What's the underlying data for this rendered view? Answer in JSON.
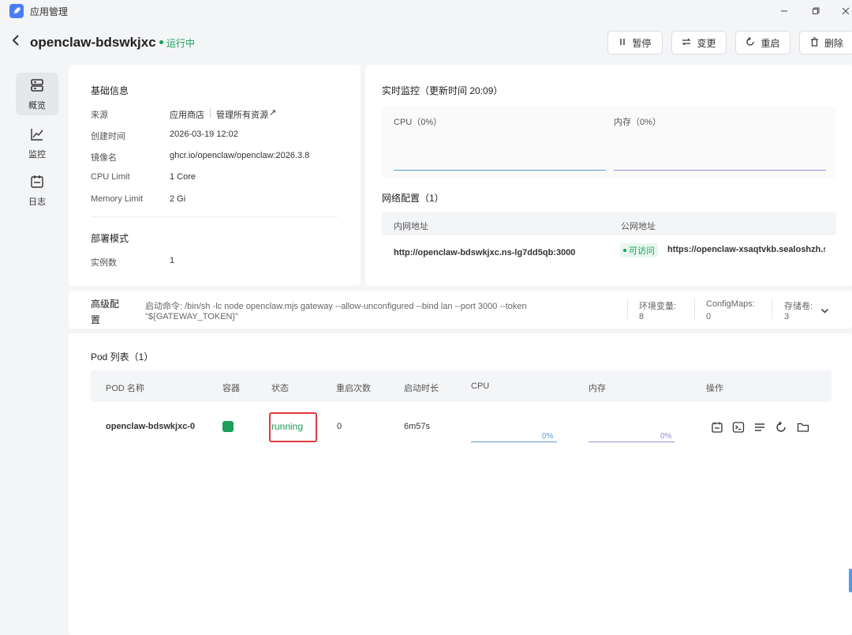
{
  "window": {
    "title": "应用管理",
    "controls": [
      "minimize",
      "restore",
      "close"
    ]
  },
  "header": {
    "app_name": "openclaw-bdswkjxc",
    "status": "运行中",
    "buttons": {
      "pause": "暂停",
      "change": "变更",
      "restart": "重启",
      "delete": "删除"
    }
  },
  "sidenav": {
    "items": [
      {
        "label": "概览",
        "icon": "server-icon",
        "active": true
      },
      {
        "label": "监控",
        "icon": "chart-line-icon",
        "active": false
      },
      {
        "label": "日志",
        "icon": "calendar-log-icon",
        "active": false
      }
    ]
  },
  "basic_info": {
    "title": "基础信息",
    "rows": [
      {
        "label": "来源",
        "value": "应用商店",
        "extra": "管理所有资源",
        "extra_icon": "↗"
      },
      {
        "label": "创建时间",
        "value": "2026-03-19 12:02"
      },
      {
        "label": "镜像名",
        "value": "ghcr.io/openclaw/openclaw:2026.3.8"
      },
      {
        "label": "CPU Limit",
        "value": "1 Core"
      },
      {
        "label": "Memory Limit",
        "value": "2 Gi"
      }
    ],
    "deploy_title": "部署模式",
    "deploy_rows": [
      {
        "label": "实例数",
        "value": "1"
      }
    ]
  },
  "monitor": {
    "title": "实时监控（更新时间 20:09）",
    "cpu_label": "CPU（0%）",
    "mem_label": "内存（0%）",
    "cpu_color": "#5b9bd5",
    "mem_color": "#9b8bd6"
  },
  "network": {
    "title": "网络配置（1）",
    "col_internal": "内网地址",
    "col_public": "公网地址",
    "internal": "http://openclaw-bdswkjxc.ns-lg7dd5qb:3000",
    "reachable": "可访问",
    "public": "https://openclaw-xsaqtvkb.sealoshzh.site"
  },
  "advanced": {
    "title_line1": "高级配",
    "title_line2": "置",
    "command_line1": "启动命令: /bin/sh -lc node openclaw.mjs gateway --allow-unconfigured --bind lan --port 3000 --token",
    "command_line2": "\"${GATEWAY_TOKEN}\"",
    "env_label": "环境变量:",
    "env_value": "8",
    "cm_label": "ConfigMaps:",
    "cm_value": "0",
    "storage_label": "存储卷:",
    "storage_value": "3"
  },
  "pods": {
    "title": "Pod 列表（1）",
    "columns": [
      "POD 名称",
      "容器",
      "状态",
      "重启次数",
      "启动时长",
      "CPU",
      "内存",
      "操作"
    ],
    "rows": [
      {
        "name": "openclaw-bdswkjxc-0",
        "container_color": "#1a9e5a",
        "status": "running",
        "restarts": "0",
        "uptime": "6m57s",
        "cpu": "0%",
        "mem": "0%"
      }
    ],
    "highlight_color": "#e0393e"
  }
}
